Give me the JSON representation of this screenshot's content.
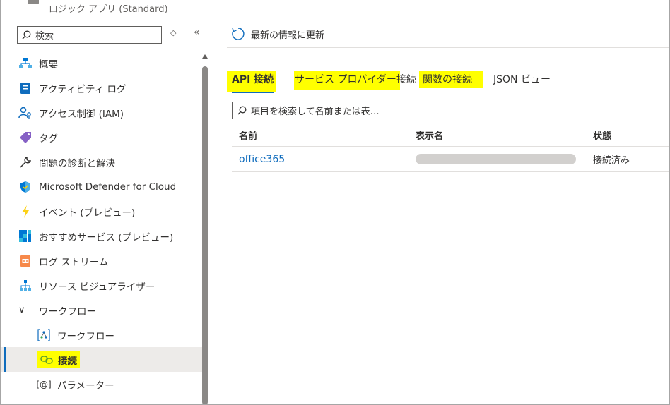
{
  "app": {
    "subtitle": "ロジック アプリ (Standard)"
  },
  "sidebar": {
    "search_placeholder": "検索",
    "updown_glyph": "◇",
    "collapse_glyph": "«",
    "items": [
      {
        "label": "概要",
        "icon": "overview-icon"
      },
      {
        "label": "アクティビティ ログ",
        "icon": "activity-log-icon"
      },
      {
        "label": "アクセス制御 (IAM)",
        "icon": "iam-icon"
      },
      {
        "label": "タグ",
        "icon": "tag-icon"
      },
      {
        "label": "問題の診断と解決",
        "icon": "wrench-icon"
      },
      {
        "label": "Microsoft Defender for Cloud",
        "icon": "shield-icon"
      },
      {
        "label": "イベント (プレビュー)",
        "icon": "lightning-icon"
      },
      {
        "label": "おすすめサービス (プレビュー)",
        "icon": "grid-icon"
      },
      {
        "label": "ログ ストリーム",
        "icon": "log-stream-icon"
      },
      {
        "label": "リソース ビジュアライザー",
        "icon": "visualizer-icon"
      }
    ],
    "group": {
      "label": "ワークフロー",
      "chevron": "∨"
    },
    "sub_items": [
      {
        "label": "ワークフロー",
        "icon": "workflow-icon"
      },
      {
        "label": "接続",
        "icon": "connection-icon",
        "active": true
      },
      {
        "label": "パラメーター",
        "icon": "parameters-icon",
        "glyph": "[@]"
      }
    ]
  },
  "toolbar": {
    "refresh_label": "最新の情報に更新"
  },
  "tabs": [
    {
      "label": "API 接続",
      "active": true,
      "highlighted": true
    },
    {
      "label": "サービス プロバイダー接続",
      "highlighted": true
    },
    {
      "label": "関数の接続",
      "highlighted": true
    },
    {
      "label": "JSON ビュー",
      "highlighted": false
    }
  ],
  "filter": {
    "placeholder": "項目を検索して名前または表…"
  },
  "table": {
    "columns": [
      "名前",
      "表示名",
      "状態"
    ],
    "rows": [
      {
        "name": "office365",
        "display_name": "",
        "status": "接続済み"
      }
    ]
  },
  "colors": {
    "accent": "#0f6cbd",
    "highlight": "#ffff00",
    "active_bg": "#edebe9"
  }
}
